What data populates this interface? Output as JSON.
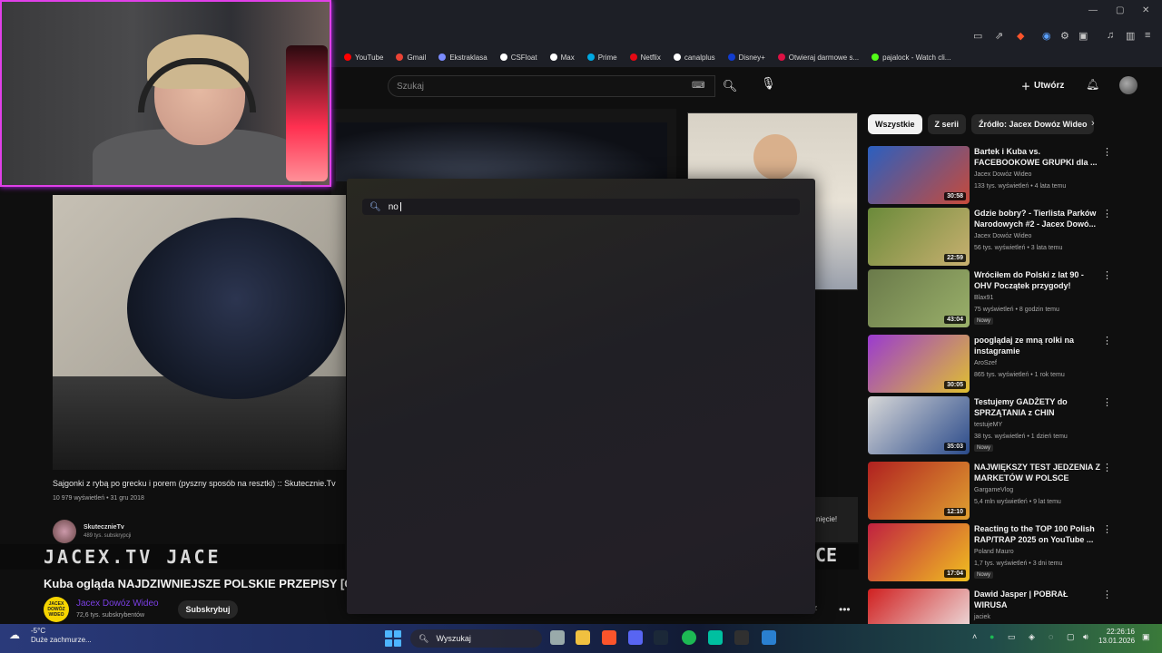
{
  "browser": {
    "bookmarks": [
      {
        "label": "YouTube",
        "color": "#ff0000"
      },
      {
        "label": "Gmail",
        "color": "#ea4335"
      },
      {
        "label": "Ekstraklasa",
        "color": "#7b8cff"
      },
      {
        "label": "CSFloat",
        "color": "#ffffff"
      },
      {
        "label": "Max",
        "color": "#ffffff"
      },
      {
        "label": "Prime",
        "color": "#00a8e1"
      },
      {
        "label": "Netflix",
        "color": "#e50914"
      },
      {
        "label": "canalplus",
        "color": "#ffffff"
      },
      {
        "label": "Disney+",
        "color": "#113ccf"
      },
      {
        "label": "Otwieraj darmowe s...",
        "color": "#d14"
      },
      {
        "label": "pajalock - Watch cli...",
        "color": "#53fc18"
      }
    ]
  },
  "youtube": {
    "search_placeholder": "Szukaj",
    "create_label": "Utwórz",
    "chips": [
      "Wszystkie",
      "Z serii",
      "Źródło: Jacex Dowóz Wideo"
    ]
  },
  "pip": {
    "title": "Sajgonki z rybą po grecku i porem (pyszny sposób na resztki) :: Skutecznie.Tv",
    "meta": "10 979 wyświetleń • 31 gru 2018",
    "channel": "SkutecznieTv",
    "subs": "489 tys. subskrypcji"
  },
  "banner": {
    "text": "JACEX.TV   JACE",
    "right": "CE"
  },
  "video": {
    "title": "Kuba ogląda NAJDZIWNIEJSZE POLSKIE PRZEPISY [CZ",
    "channel_logo": "JACEX DOWÓZ WIDEO",
    "channel": "Jacex Dowóz Wideo",
    "subs": "72,6 tys. subskrybentów",
    "subscribe": "Subskrybuj",
    "notice": "nięcie!",
    "dim_row": "rz"
  },
  "overlay": {
    "query": "no"
  },
  "sidebar": [
    {
      "title": "Bartek i Kuba vs. FACEBOOKOWE GRUPKI dla ...",
      "channel": "Jacex Dowóz Wideo",
      "stats": "133 tys. wyświetleń • 4 lata temu",
      "duration": "30:58",
      "new": "",
      "colors": [
        "#2a5fc0",
        "#c84a3a"
      ]
    },
    {
      "title": "Gdzie bobry? - Tierlista Parków Narodowych #2 - Jacex Dowó...",
      "channel": "Jacex Dowóz Wideo",
      "stats": "56 tys. wyświetleń • 3 lata temu",
      "duration": "22:59",
      "new": "",
      "colors": [
        "#6a8a3a",
        "#c8b070"
      ]
    },
    {
      "title": "Wróciłem do Polski z lat 90 - OHV Początek przygody!",
      "channel": "Blax91",
      "stats": "75 wyświetleń • 8 godzin temu",
      "duration": "43:04",
      "new": "Nowy",
      "colors": [
        "#6a7a4a",
        "#9ab06a"
      ]
    },
    {
      "title": "pooglądaj ze mną rolki na instagramie",
      "channel": "AroSzef",
      "stats": "865 tys. wyświetleń • 1 rok temu",
      "duration": "30:05",
      "new": "",
      "colors": [
        "#9a3ad0",
        "#e0c030"
      ]
    },
    {
      "title": "Testujemy GADŻETY do SPRZĄTANIA z CHIN",
      "channel": "testujeMY",
      "stats": "38 tys. wyświetleń • 1 dzień temu",
      "duration": "35:03",
      "new": "Nowy",
      "colors": [
        "#d8d8d8",
        "#2a4a8a"
      ]
    },
    {
      "title": "NAJWIĘKSZY TEST JEDZENIA Z MARKETÓW W POLSCE",
      "channel": "GargameVlog",
      "stats": "5,4 mln wyświetleń • 9 lat temu",
      "duration": "12:10",
      "new": "",
      "colors": [
        "#b02020",
        "#e0a030"
      ]
    },
    {
      "title": "Reacting to the TOP 100 Polish RAP/TRAP 2025 on YouTube ...",
      "channel": "Poland Mauro",
      "stats": "1,7 tys. wyświetleń • 3 dni temu",
      "duration": "17:04",
      "new": "Nowy",
      "colors": [
        "#c02040",
        "#f0c020"
      ]
    },
    {
      "title": "Dawid Jasper | POBRAŁ WIRUSA",
      "channel": "jaciek",
      "stats": "",
      "duration": "",
      "new": "",
      "colors": [
        "#d02020",
        "#f0f0f0"
      ]
    }
  ],
  "taskbar": {
    "weather_temp": "-5°C",
    "weather_desc": "Duże zachmurze...",
    "search": "Wyszukaj",
    "time": "22:26:16",
    "date": "13.01.2026"
  }
}
